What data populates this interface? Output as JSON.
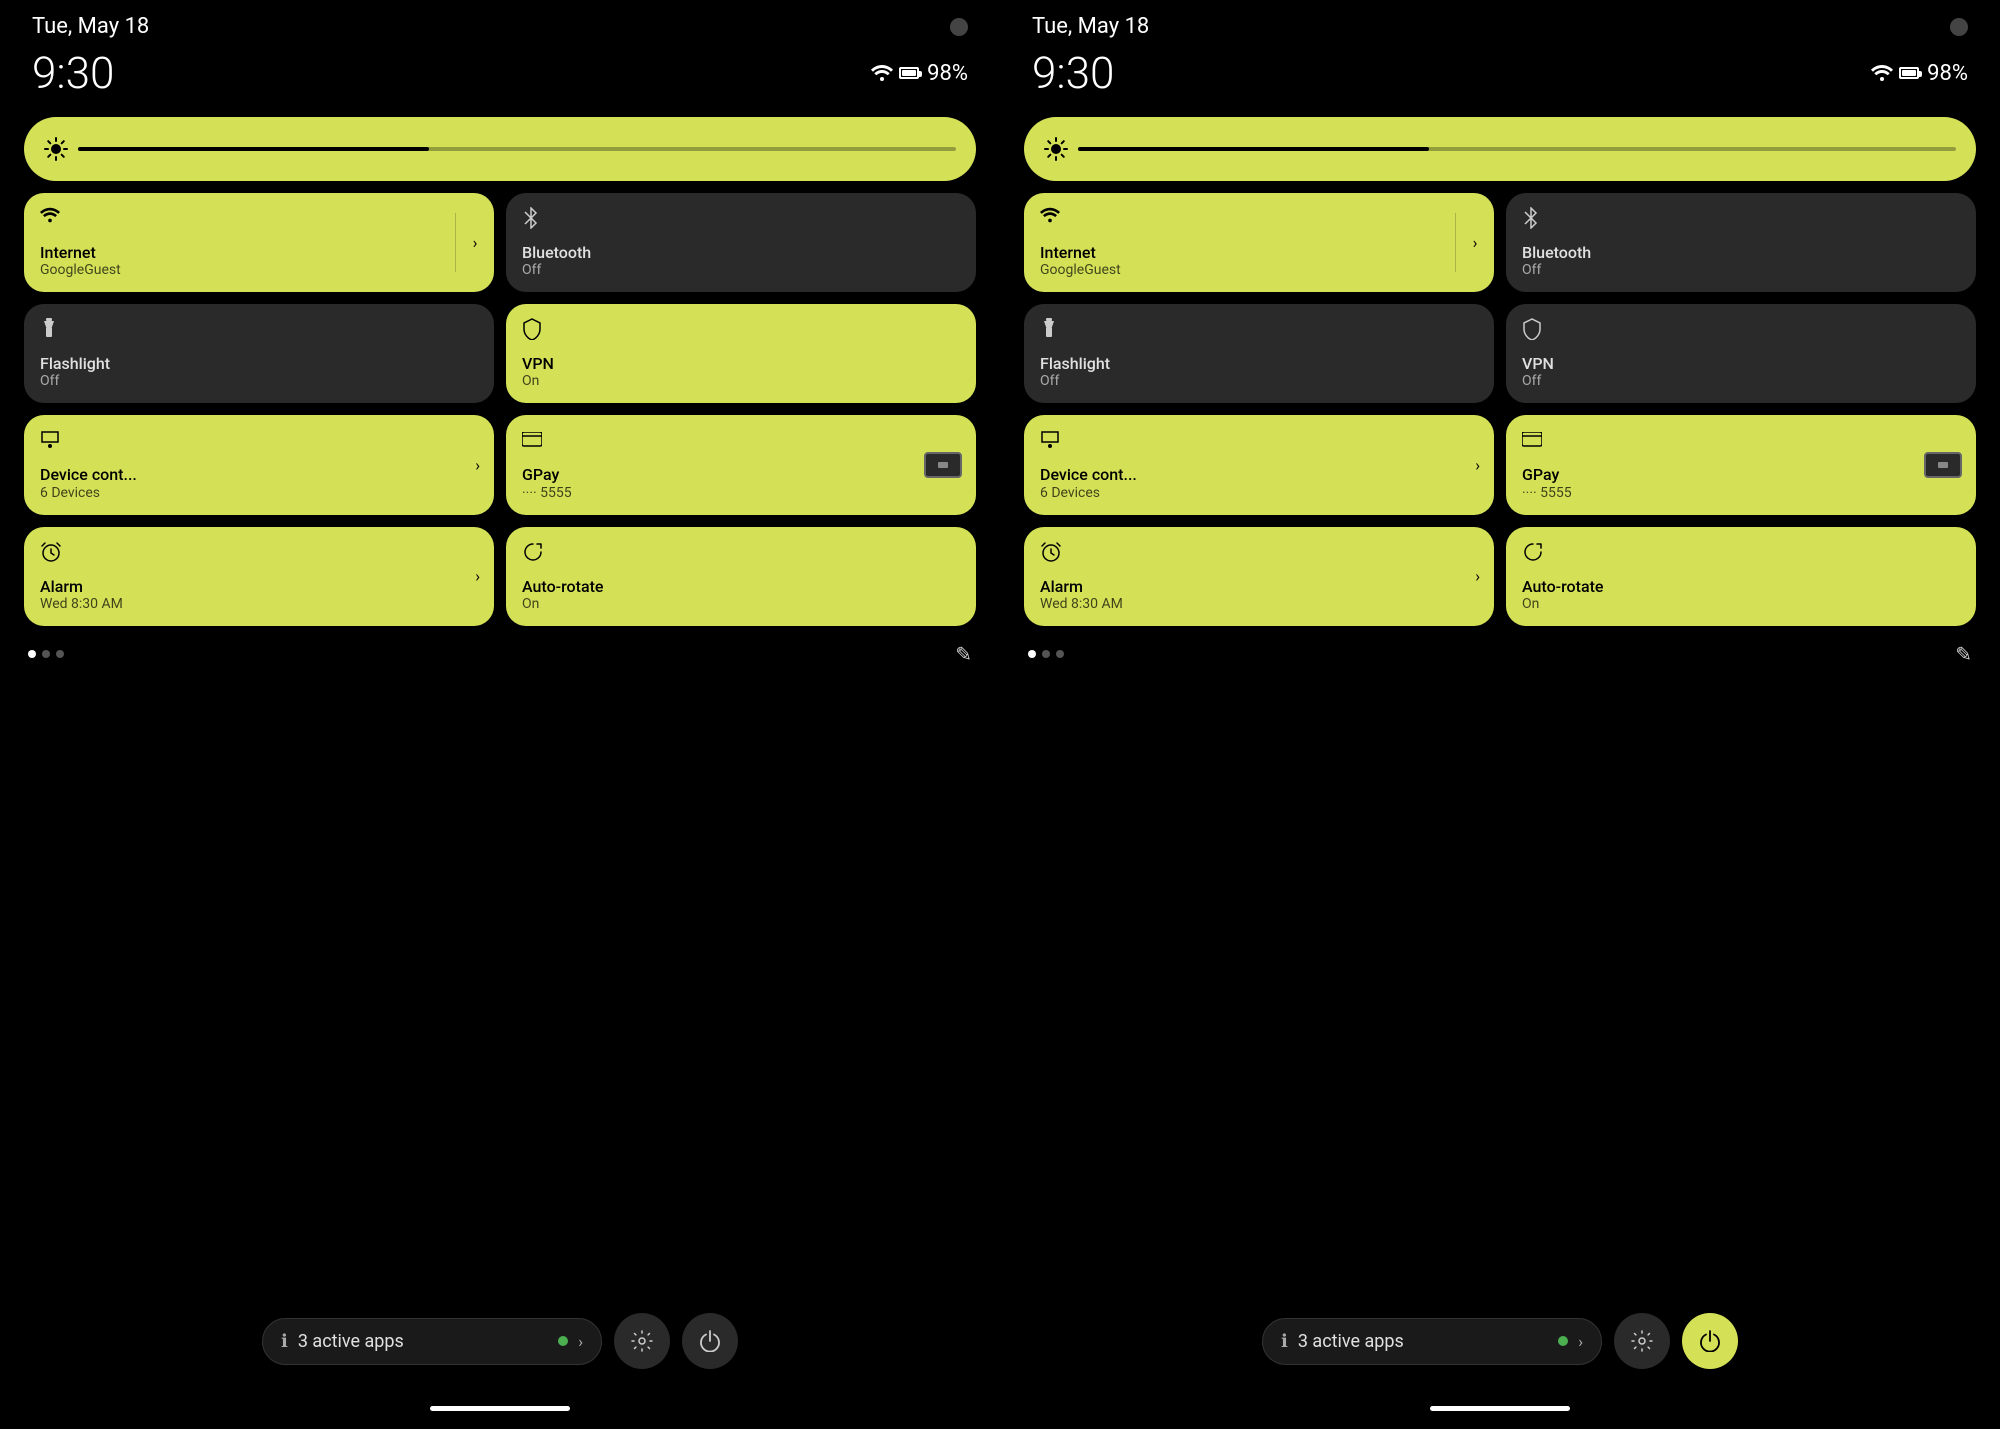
{
  "colors": {
    "active_tile": "#d4e157",
    "inactive_tile": "#2a2a2a",
    "background": "#000000"
  },
  "panel_left": {
    "date": "Tue, May 18",
    "time": "9:30",
    "battery": "98%",
    "brightness_label": "brightness",
    "tiles": [
      {
        "id": "internet",
        "label": "Internet",
        "sublabel": "GoogleGuest",
        "state": "active",
        "has_arrow": true,
        "icon": "wifi"
      },
      {
        "id": "bluetooth",
        "label": "Bluetooth",
        "sublabel": "Off",
        "state": "inactive",
        "icon": "bluetooth"
      },
      {
        "id": "flashlight",
        "label": "Flashlight",
        "sublabel": "Off",
        "state": "inactive",
        "icon": "flashlight"
      },
      {
        "id": "vpn",
        "label": "VPN",
        "sublabel": "On",
        "state": "active",
        "icon": "vpn"
      },
      {
        "id": "device",
        "label": "Device cont...",
        "sublabel": "6 Devices",
        "state": "active",
        "has_arrow": true,
        "icon": "device"
      },
      {
        "id": "gpay",
        "label": "GPay",
        "sublabel": "···· 5555",
        "state": "active",
        "icon": "gpay"
      },
      {
        "id": "alarm",
        "label": "Alarm",
        "sublabel": "Wed 8:30 AM",
        "state": "active",
        "has_arrow": true,
        "icon": "alarm"
      },
      {
        "id": "autorotate",
        "label": "Auto-rotate",
        "sublabel": "On",
        "state": "active",
        "icon": "autorotate"
      }
    ],
    "active_apps_count": "3 active apps",
    "pagination": {
      "active": 0,
      "total": 3
    }
  },
  "panel_right": {
    "date": "Tue, May 18",
    "time": "9:30",
    "battery": "98%",
    "brightness_label": "brightness",
    "tiles": [
      {
        "id": "internet",
        "label": "Internet",
        "sublabel": "GoogleGuest",
        "state": "active",
        "has_arrow": true,
        "icon": "wifi"
      },
      {
        "id": "bluetooth",
        "label": "Bluetooth",
        "sublabel": "Off",
        "state": "inactive",
        "icon": "bluetooth"
      },
      {
        "id": "flashlight",
        "label": "Flashlight",
        "sublabel": "Off",
        "state": "inactive",
        "icon": "flashlight"
      },
      {
        "id": "vpn",
        "label": "VPN",
        "sublabel": "Off",
        "state": "inactive",
        "icon": "vpn"
      },
      {
        "id": "device",
        "label": "Device cont...",
        "sublabel": "6 Devices",
        "state": "active",
        "has_arrow": true,
        "icon": "device"
      },
      {
        "id": "gpay",
        "label": "GPay",
        "sublabel": "···· 5555",
        "state": "active",
        "icon": "gpay"
      },
      {
        "id": "alarm",
        "label": "Alarm",
        "sublabel": "Wed 8:30 AM",
        "state": "active",
        "has_arrow": true,
        "icon": "alarm"
      },
      {
        "id": "autorotate",
        "label": "Auto-rotate",
        "sublabel": "On",
        "state": "active",
        "icon": "autorotate"
      }
    ],
    "active_apps_count": "3 active apps",
    "pagination": {
      "active": 0,
      "total": 3
    }
  }
}
